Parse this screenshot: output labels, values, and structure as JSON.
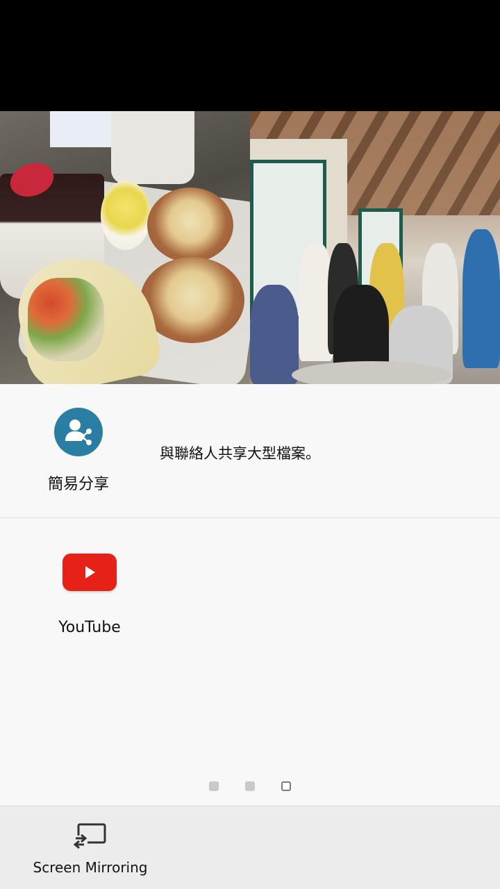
{
  "preview": {
    "images": [
      {
        "name": "food-photo"
      },
      {
        "name": "event-photo"
      }
    ]
  },
  "share_sheet": {
    "easy_share": {
      "label": "簡易分享",
      "description": "與聯絡人共享大型檔案。",
      "icon": "easy-share-icon",
      "icon_color": "#2a7ea3"
    },
    "apps": [
      {
        "label": "YouTube",
        "icon": "youtube-icon",
        "icon_color": "#e62117"
      }
    ],
    "pager": {
      "pages": 3,
      "active_index": 2
    }
  },
  "bottom_bar": {
    "screen_mirroring": {
      "label": "Screen Mirroring",
      "icon": "screen-mirroring-icon"
    }
  }
}
